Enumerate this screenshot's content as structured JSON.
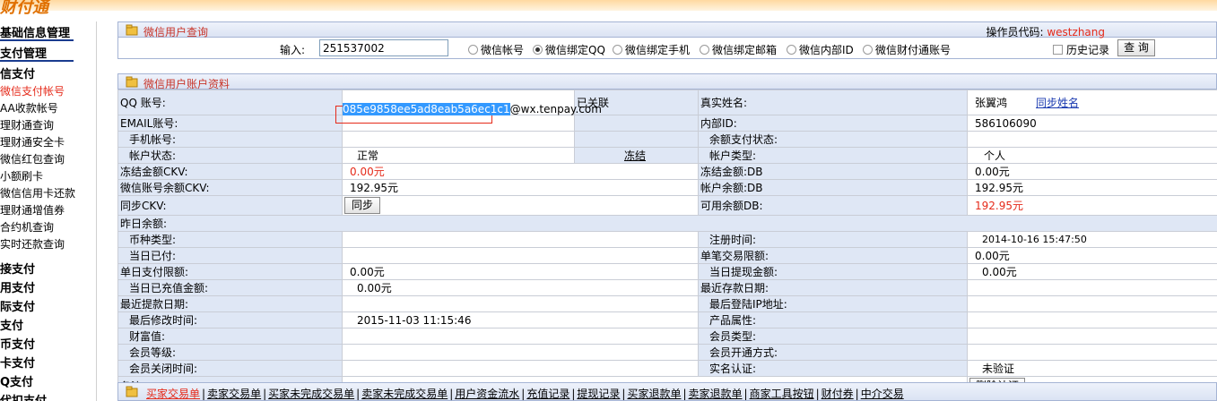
{
  "logo_text": "财付通",
  "sidebar": {
    "heading1": "基础信息管理",
    "heading2": "支付管理",
    "heading3": "信支付",
    "items": [
      "微信支付帐号",
      "AA收款帐号",
      "理财通查询",
      "理财通安全卡",
      "微信红包查询",
      "小额刷卡",
      "微信信用卡还款",
      "理财通增值券",
      "合约机查询",
      "实时还款查询"
    ],
    "groups": [
      "接支付",
      "用支付",
      "际支付",
      "支付",
      "币支付",
      "卡支付",
      "Q支付",
      "代扣支付"
    ]
  },
  "query_panel": {
    "title": "微信用户查询",
    "operator_label": "操作员代码:",
    "operator": "westzhang",
    "input_label": "输入:",
    "input_value": "251537002",
    "radios": [
      "微信帐号",
      "微信绑定QQ",
      "微信绑定手机",
      "微信绑定邮箱",
      "微信内部ID",
      "微信财付通账号"
    ],
    "selected_radio": "微信绑定QQ",
    "history_label": "历史记录",
    "query_button": "查 询"
  },
  "account_panel": {
    "title": "微信用户账户资料",
    "qq_label": "QQ 账号:",
    "qq_selected": "085e9858ee5ad8eab5a6ec1c1",
    "qq_suffix": "@wx.tenpay.com",
    "linked_label": "已关联",
    "realname_label": "真实姓名:",
    "realname": "张翼鸿",
    "sync_name": "同步姓名",
    "email_label": "EMAIL账号:",
    "internal_id_label": "内部ID:",
    "internal_id": "586106090",
    "phone_label": "手机帐号:",
    "balance_status_label": "余额支付状态:",
    "account_status_label": "帐户状态:",
    "account_status": "正常",
    "freeze_link": "冻结",
    "account_type_label": "帐户类型:",
    "account_type": "个人",
    "frozen_ckv_label": "冻结金额CKV:",
    "frozen_ckv": "0.00元",
    "frozen_db_label": "冻结金额:DB",
    "frozen_db": "0.00元",
    "wx_balance_ckv_label": "微信账号余额CKV:",
    "wx_balance_ckv": "192.95元",
    "balance_db_label": "帐户余额:DB",
    "balance_db": "192.95元",
    "sync_ckv_label": "同步CKV:",
    "sync_button": "同步",
    "available_db_label": "可用余额DB:",
    "available_db": "192.95元",
    "yesterday_balance_label": "昨日余额:",
    "currency_type_label": "币种类型:",
    "register_time_label": "注册时间:",
    "register_time": "2014-10-16 15:47:50",
    "today_paid_label": "当日已付:",
    "single_limit_label": "单笔交易限额:",
    "single_limit": "0.00元",
    "daily_limit_label": "单日支付限额:",
    "daily_limit": "0.00元",
    "today_withdraw_label": "当日提现金额:",
    "today_withdraw": "0.00元",
    "today_topup_label": "当日已充值金额:",
    "today_topup": "0.00元",
    "last_deposit_label": "最近存款日期:",
    "last_withdraw_label": "最近提款日期:",
    "last_login_ip_label": "最后登陆IP地址:",
    "last_modify_label": "最后修改时间:",
    "last_modify": "2015-11-03 11:15:46",
    "product_attr_label": "产品属性:",
    "wealth_label": "财富值:",
    "member_type_label": "会员类型:",
    "member_level_label": "会员等级:",
    "member_open_label": "会员开通方式:",
    "member_close_label": "会员关闭时间:",
    "realname_auth_label": "实名认证:",
    "realname_auth": "未验证",
    "remark_label": "备注:",
    "delete_auth_button": "删除认证"
  },
  "bottom_tabs": [
    "买家交易单",
    "卖家交易单",
    "买家未完成交易单",
    "卖家未完成交易单",
    "用户资金流水",
    "充值记录",
    "提现记录",
    "买家退款单",
    "卖家退款单",
    "商家工具按钮",
    "财付券",
    "中介交易"
  ]
}
